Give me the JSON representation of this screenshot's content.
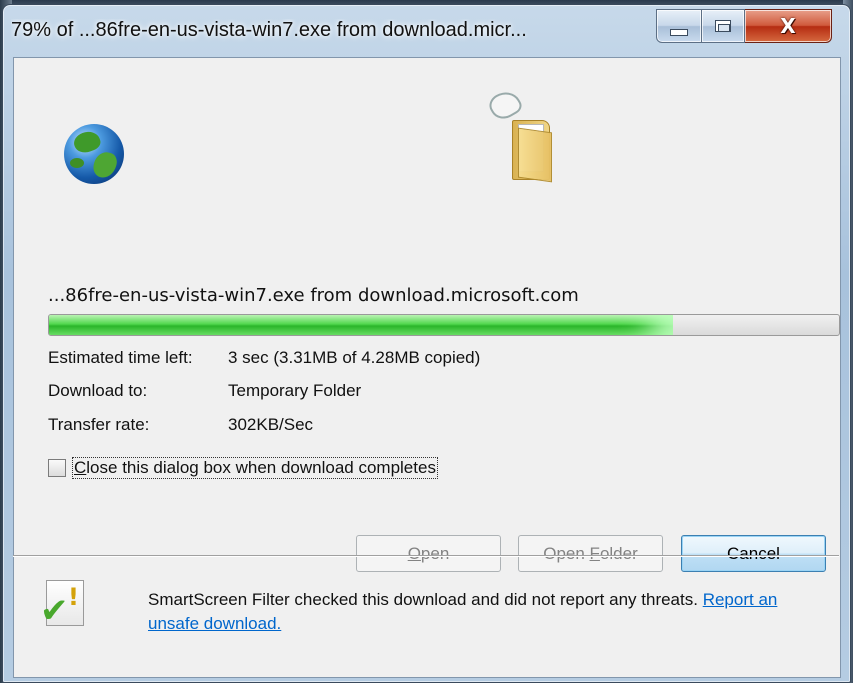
{
  "window": {
    "title": "79% of ...86fre-en-us-vista-win7.exe from download.micr...",
    "close_glyph": "X"
  },
  "download": {
    "filename_line": "...86fre-en-us-vista-win7.exe from download.microsoft.com",
    "progress_percent": 79,
    "estimated_time_label": "Estimated time left:",
    "estimated_time_value": "3 sec (3.31MB of 4.28MB copied)",
    "download_to_label": "Download to:",
    "download_to_value": "Temporary Folder",
    "transfer_rate_label": "Transfer rate:",
    "transfer_rate_value": "302KB/Sec"
  },
  "checkbox": {
    "checked": false,
    "label_first": "C",
    "label_rest": "lose this dialog box when download completes"
  },
  "buttons": {
    "open_mnemonic": "O",
    "open_rest": "pen",
    "open_folder_prefix": "Open ",
    "open_folder_mnemonic": "F",
    "open_folder_rest": "older",
    "cancel": "Cancel"
  },
  "smartscreen": {
    "message": "SmartScreen Filter checked this download and did not report any threats.",
    "link": "Report an unsafe download."
  },
  "colors": {
    "progress_fill": "#25b324",
    "link": "#0066cc",
    "default_button_border": "#3c7fb1"
  },
  "icons": {
    "globe": "globe-icon",
    "folder_animation": "folder-animation-icon",
    "smartscreen": "smartscreen-shield-icon"
  }
}
